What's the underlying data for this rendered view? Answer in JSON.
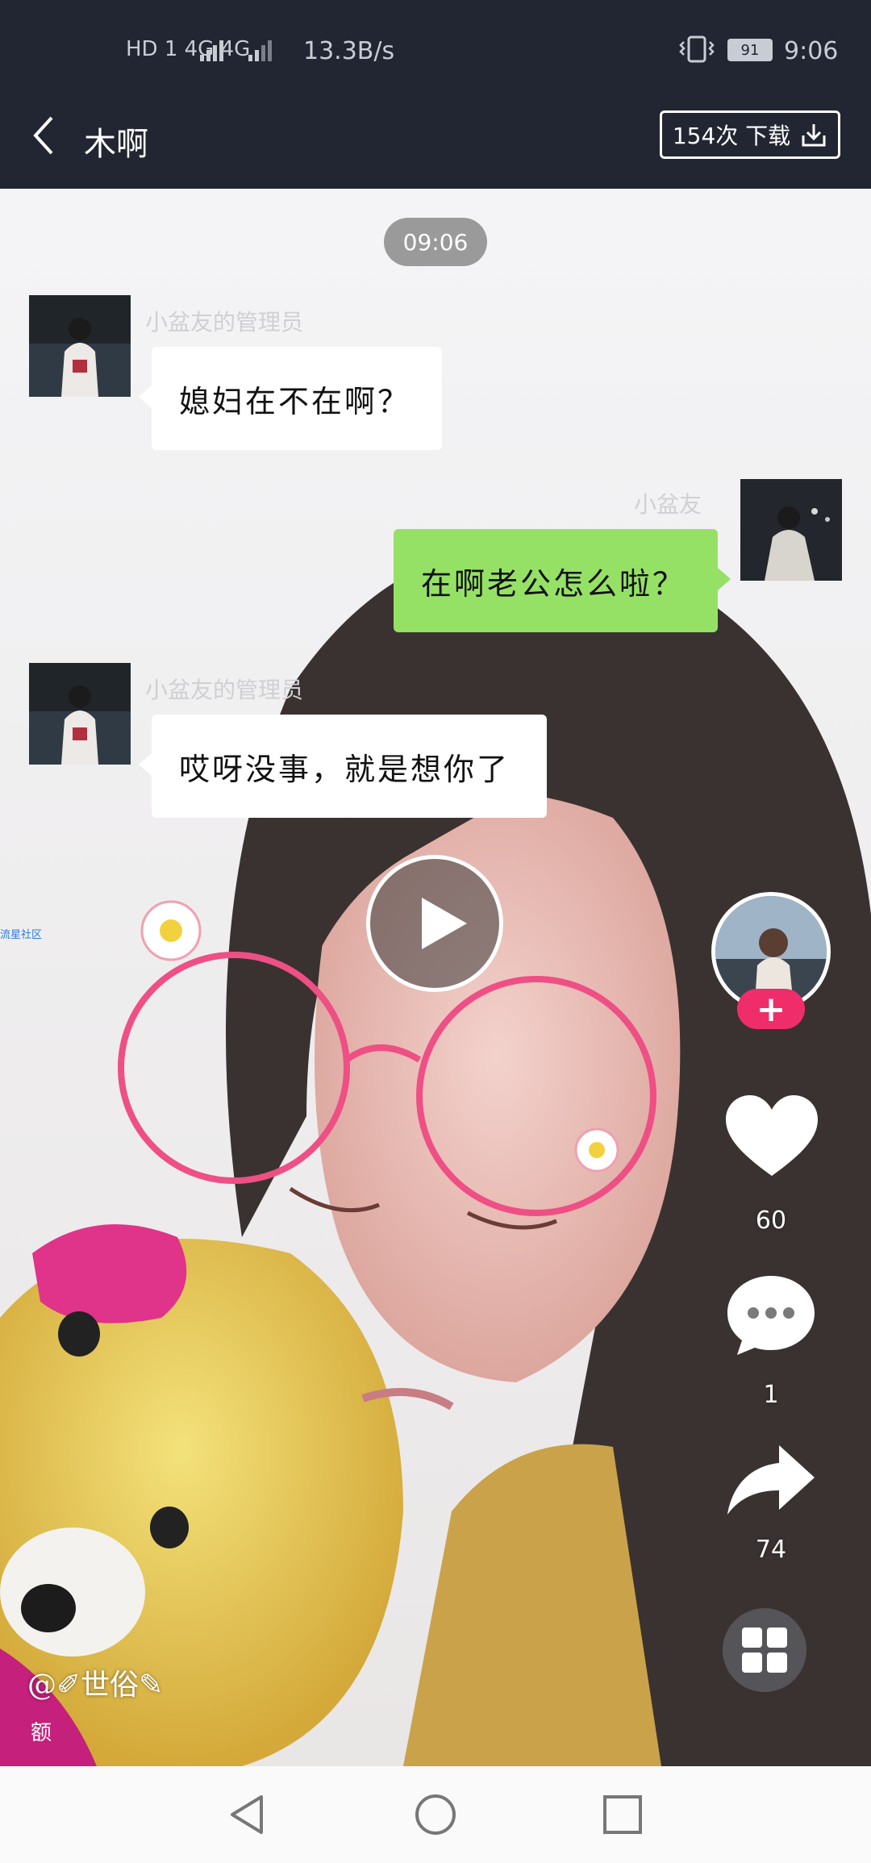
{
  "status_bar": {
    "network": "HD 1 4G 4G",
    "speed": "13.3B/s",
    "battery": "91",
    "time": "9:06"
  },
  "header": {
    "back_icon": "chevron-left-icon",
    "title": "木啊",
    "download_label": "154次 下载"
  },
  "chat": {
    "timestamp": "09:06",
    "messages": [
      {
        "side": "left",
        "name": "小盆友的管理员",
        "text": "媳妇在不在啊？"
      },
      {
        "side": "right",
        "name": "小盆友",
        "text": "在啊老公怎么啦？"
      },
      {
        "side": "left",
        "name": "小盆友的管理员",
        "text": "哎呀没事，就是想你了"
      }
    ]
  },
  "side_link": "流星社区",
  "actions": {
    "likes": "60",
    "comments": "1",
    "shares": "74"
  },
  "video": {
    "handle": "@✐世俗✎",
    "desc": "额"
  },
  "colors": {
    "bar": "#222632",
    "bubble_green": "#95e165",
    "follow_pink": "#f02d6b"
  }
}
